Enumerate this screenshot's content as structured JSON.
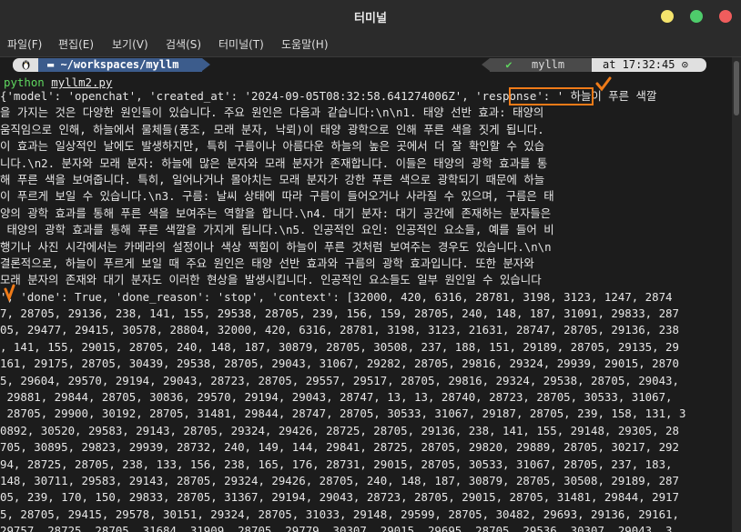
{
  "window": {
    "title": "터미널"
  },
  "menu": [
    {
      "label": "파일(F)"
    },
    {
      "label": "편집(E)"
    },
    {
      "label": "보기(V)"
    },
    {
      "label": "검색(S)"
    },
    {
      "label": "터미널(T)"
    },
    {
      "label": "도움말(H)"
    }
  ],
  "prompt": {
    "path": "~/workspaces/myllm",
    "check": "✔",
    "user": "myllm",
    "time": "at 17:32:45 ⊙"
  },
  "command": {
    "exec": "python",
    "file": "myllm2.py"
  },
  "output_lines": [
    "{'model': 'openchat', 'created_at': '2024-09-05T08:32:58.641274006Z', 'response': ' 하늘이 푸른 색깔",
    "을 가지는 것은 다양한 원인들이 있습니다. 주요 원인은 다음과 같습니다:\\n\\n1. 태양 선반 효과: 태양의",
    "움직임으로 인해, 하늘에서 물체들(풍조, 모래 분자, 낙뢰)이 태양 광학으로 인해 푸른 색을 짓게 됩니다.",
    "이 효과는 일상적인 날에도 발생하지만, 특히 구름이나 아름다운 하늘의 높은 곳에서 더 잘 확인할 수 있습",
    "니다.\\n2. 분자와 모래 분자: 하늘에 많은 분자와 모래 분자가 존재합니다. 이들은 태양의 광학 효과를 통",
    "해 푸른 색을 보여줍니다. 특히, 일어나거나 몰아치는 모래 분자가 강한 푸른 색으로 광학되기 때문에 하늘",
    "이 푸르게 보일 수 있습니다.\\n3. 구름: 날씨 상태에 따라 구름이 들어오거나 사라질 수 있으며, 구름은 태",
    "양의 광학 효과를 통해 푸른 색을 보여주는 역할을 합니다.\\n4. 대기 분자: 대기 공간에 존재하는 분자들은",
    " 태양의 광학 효과를 통해 푸른 색깔을 가지게 됩니다.\\n5. 인공적인 요인: 인공적인 요소들, 예를 들어 비",
    "행기나 사진 시각에서는 카메라의 설정이나 색상 찍힘이 하늘이 푸른 것처럼 보여주는 경우도 있습니다.\\n\\n",
    "결론적으로, 하늘이 푸르게 보일 때 주요 원인은 태양 선반 효과와 구름의 광학 효과입니다. 또한 분자와",
    "모래 분자의 존재와 대기 분자도 이러한 현상을 발생시킵니다. 인공적인 요소들도 일부 원인일 수 있습니다",
    "', 'done': True, 'done_reason': 'stop', 'context': [32000, 420, 6316, 28781, 3198, 3123, 1247, 2874",
    "7, 28705, 29136, 238, 141, 155, 29538, 28705, 239, 156, 159, 28705, 240, 148, 187, 31091, 29833, 287",
    "05, 29477, 29415, 30578, 28804, 32000, 420, 6316, 28781, 3198, 3123, 21631, 28747, 28705, 29136, 238",
    ", 141, 155, 29015, 28705, 240, 148, 187, 30879, 28705, 30508, 237, 188, 151, 29189, 28705, 29135, 29",
    "161, 29175, 28705, 30439, 29538, 28705, 29043, 31067, 29282, 28705, 29816, 29324, 29939, 29015, 2870",
    "5, 29604, 29570, 29194, 29043, 28723, 28705, 29557, 29517, 28705, 29816, 29324, 29538, 28705, 29043,",
    " 29881, 29844, 28705, 30836, 29570, 29194, 29043, 28747, 13, 13, 28740, 28723, 28705, 30533, 31067,",
    " 28705, 29900, 30192, 28705, 31481, 29844, 28747, 28705, 30533, 31067, 29187, 28705, 239, 158, 131, 3",
    "0892, 30520, 29583, 29143, 28705, 29324, 29426, 28725, 28705, 29136, 238, 141, 155, 29148, 29305, 28",
    "705, 30895, 29823, 29939, 28732, 240, 149, 144, 29841, 28725, 28705, 29820, 29889, 28705, 30217, 292",
    "94, 28725, 28705, 238, 133, 156, 238, 165, 176, 28731, 29015, 28705, 30533, 31067, 28705, 237, 183,",
    "148, 30711, 29583, 29143, 28705, 29324, 29426, 28705, 240, 148, 187, 30879, 28705, 30508, 29189, 287",
    "05, 239, 170, 150, 29833, 28705, 31367, 29194, 29043, 28723, 28705, 29015, 28705, 31481, 29844, 2917",
    "5, 28705, 29415, 29578, 30151, 29324, 28705, 31033, 29148, 29599, 28705, 30482, 29693, 29136, 29161,",
    "29757, 28725, 28705, 31684, 31909, 28705, 29779, 30307, 29015, 29695, 28705, 29536, 30307, 29043, 3"
  ]
}
